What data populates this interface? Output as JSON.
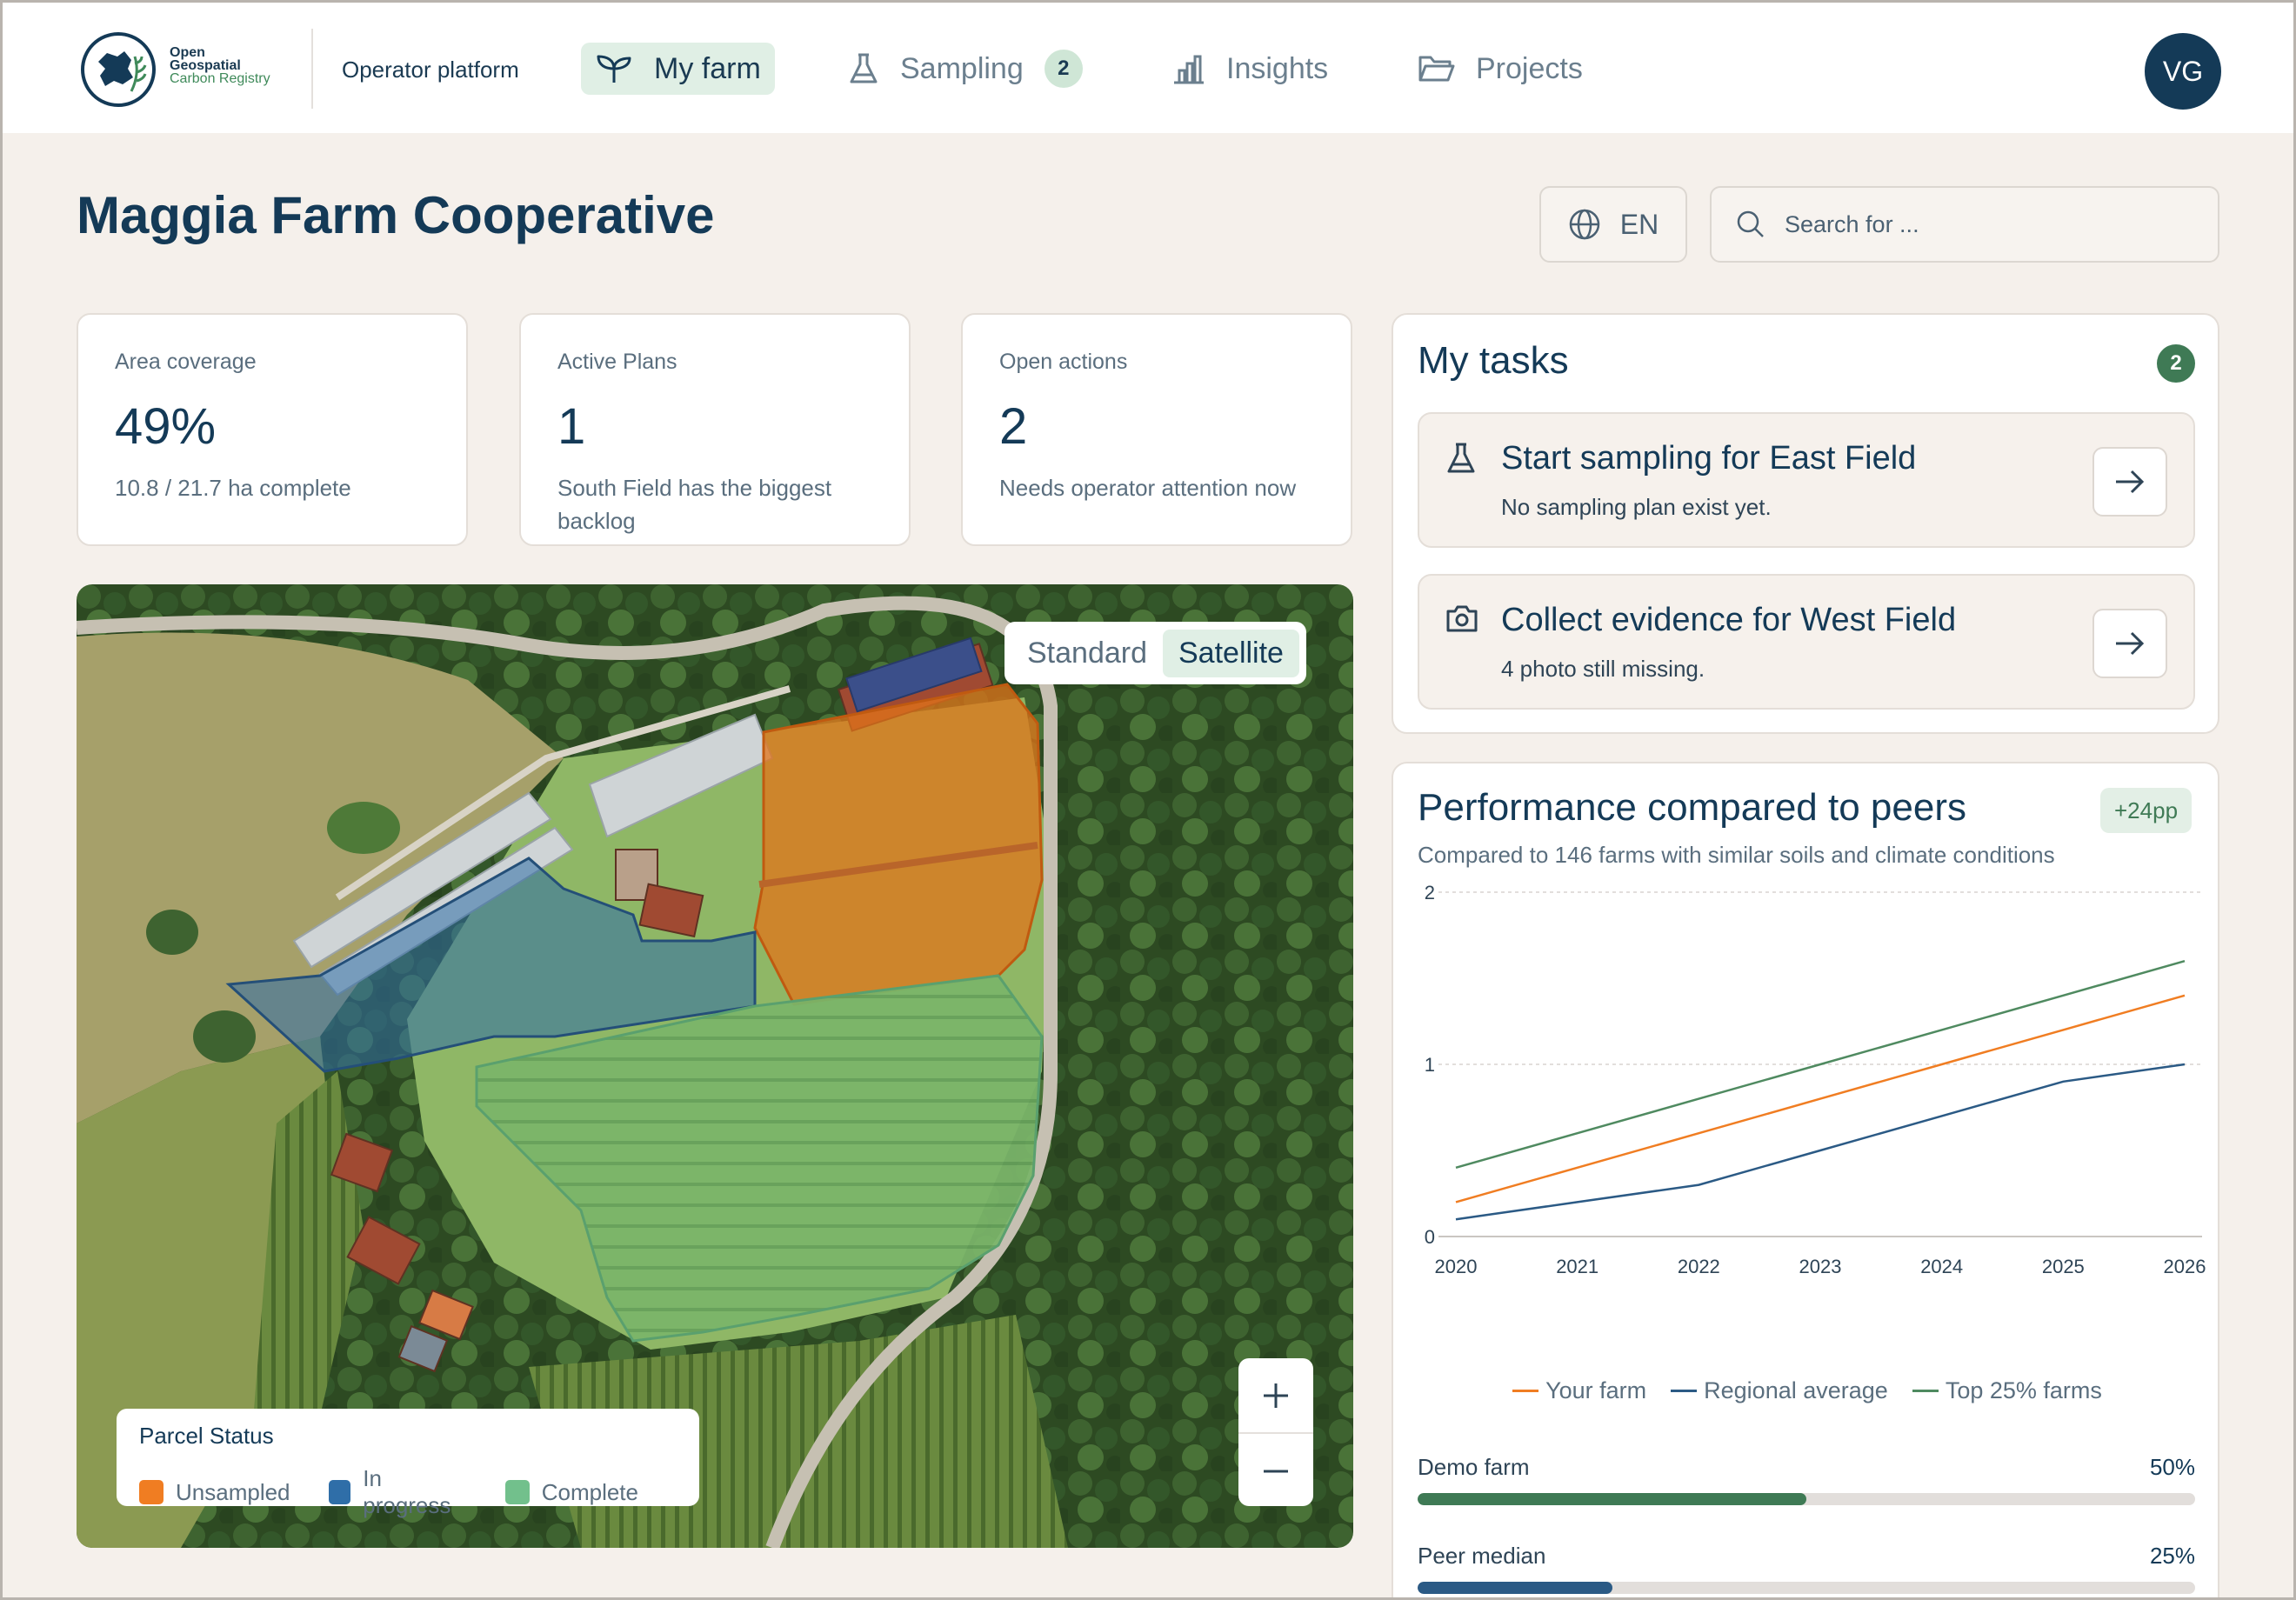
{
  "brand": {
    "line1": "Open",
    "line2": "Geospatial",
    "line3": "Carbon Registry"
  },
  "header": {
    "platform": "Operator platform",
    "nav": [
      {
        "label": "My farm",
        "icon": "sprout-icon"
      },
      {
        "label": "Sampling",
        "icon": "flask-icon",
        "badge": "2"
      },
      {
        "label": "Insights",
        "icon": "bar-chart-icon"
      },
      {
        "label": "Projects",
        "icon": "folder-icon"
      }
    ],
    "avatar": "VG"
  },
  "page": {
    "title": "Maggia Farm Cooperative"
  },
  "lang": {
    "label": "EN"
  },
  "search": {
    "placeholder": "Search for ..."
  },
  "kpis": [
    {
      "label": "Area coverage",
      "value": "49%",
      "sub": "10.8 / 21.7 ha complete"
    },
    {
      "label": "Active Plans",
      "value": "1",
      "sub": "South Field has the biggest backlog"
    },
    {
      "label": "Open actions",
      "value": "2",
      "sub": "Needs operator attention now"
    }
  ],
  "map": {
    "toggle": {
      "standard": "Standard",
      "satellite": "Satellite",
      "selected": "Satellite"
    },
    "zoom_in": "+",
    "zoom_out": "−",
    "legend": {
      "title": "Parcel Status",
      "items": [
        {
          "label": "Unsampled",
          "color": "#f07d22"
        },
        {
          "label": "In progress",
          "color": "#2f6ea8"
        },
        {
          "label": "Complete",
          "color": "#72c08c"
        }
      ]
    }
  },
  "tasks": {
    "title": "My tasks",
    "count": "2",
    "items": [
      {
        "icon": "flask-icon",
        "title": "Start sampling for East Field",
        "sub": "No sampling plan exist yet."
      },
      {
        "icon": "camera-icon",
        "title": "Collect evidence for West Field",
        "sub": "4 photo still missing."
      }
    ]
  },
  "performance": {
    "title": "Performance compared to peers",
    "badge": "+24pp",
    "subtitle": "Compared to 146 farms with similar soils and climate conditions",
    "bars": [
      {
        "label": "Demo farm",
        "value": "50%",
        "fraction": 0.5,
        "color": "#3f7a55"
      },
      {
        "label": "Peer median",
        "value": "25%",
        "fraction": 0.25,
        "color": "#2b5a85"
      }
    ]
  },
  "chart_data": {
    "type": "line",
    "x": [
      "2020",
      "2021",
      "2022",
      "2023",
      "2024",
      "2025",
      "2026"
    ],
    "ylim": [
      0,
      2
    ],
    "yticks": [
      "0",
      "1",
      "2"
    ],
    "grid": "horizontal dashed",
    "legend_position": "bottom",
    "series": [
      {
        "name": "Your farm",
        "color": "#f07d22",
        "values": [
          0.2,
          0.4,
          0.6,
          0.8,
          1.0,
          1.2,
          1.4
        ]
      },
      {
        "name": "Regional average",
        "color": "#2b5a85",
        "values": [
          0.1,
          0.2,
          0.3,
          0.5,
          0.7,
          0.9,
          1.0
        ]
      },
      {
        "name": "Top 25% farms",
        "color": "#4f8a60",
        "values": [
          0.4,
          0.6,
          0.8,
          1.0,
          1.2,
          1.4,
          1.6
        ]
      }
    ]
  }
}
